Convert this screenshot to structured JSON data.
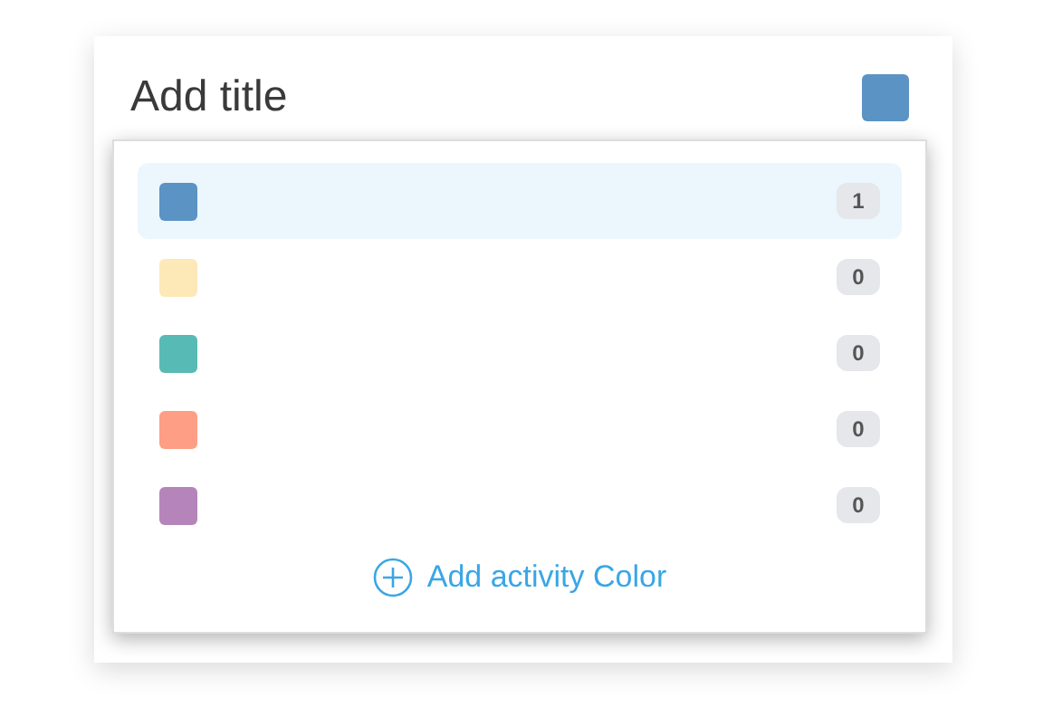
{
  "title": {
    "placeholder": "Add title"
  },
  "current": {
    "color": "#5b93c4"
  },
  "colors": [
    {
      "color": "#5b93c4",
      "count": "1",
      "selected": true
    },
    {
      "color": "#fde8b8",
      "count": "0",
      "selected": false
    },
    {
      "color": "#58bab5",
      "count": "0",
      "selected": false
    },
    {
      "color": "#fd9e85",
      "count": "0",
      "selected": false
    },
    {
      "color": "#b584ba",
      "count": "0",
      "selected": false
    }
  ],
  "add_button": "Add activity Color"
}
